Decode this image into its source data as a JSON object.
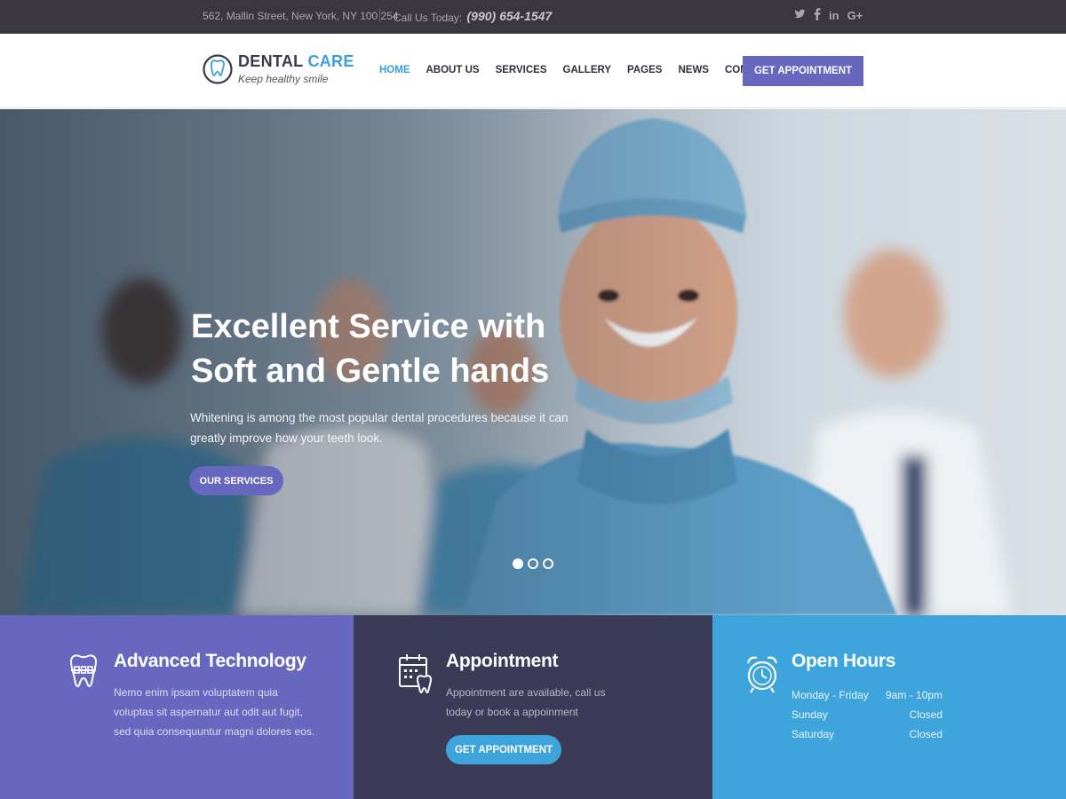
{
  "topbar": {
    "address": "562, Mallin Street, New York, NY 100 254",
    "call_label": "Call Us Today:",
    "phone": "(990) 654-1547",
    "social": [
      {
        "icon": "twitter-icon"
      },
      {
        "icon": "facebook-icon"
      },
      {
        "icon": "linkedin-icon",
        "glyph": "in"
      },
      {
        "icon": "google-plus-icon",
        "glyph": "G+"
      }
    ]
  },
  "header": {
    "logo_part1": "DENTAL",
    "logo_part2": "CARE",
    "tagline": "Keep healthy smile",
    "nav": [
      {
        "label": "HOME",
        "active": true
      },
      {
        "label": "ABOUT US"
      },
      {
        "label": "SERVICES"
      },
      {
        "label": "GALLERY"
      },
      {
        "label": "PAGES"
      },
      {
        "label": "NEWS"
      },
      {
        "label": "CONTACT US"
      }
    ],
    "cta": "GET APPOINTMENT"
  },
  "hero": {
    "title": "Excellent Service with Soft and Gentle hands",
    "text": "Whitening is among the most popular dental procedures because it can greatly improve how your teeth look.",
    "button": "OUR SERVICES",
    "slides": 3,
    "active_slide": 1
  },
  "features": {
    "tech": {
      "title": "Advanced Technology",
      "text": "Nemo enim ipsam voluptatem quia voluptas sit aspernatur aut odit aut fugit, sed quia consequuntur magni dolores eos.",
      "icon": "tooth-braces-icon"
    },
    "appointment": {
      "title": "Appointment",
      "text": "Appointment are available, call us today or book a appoinment",
      "button": "GET APPOINTMENT",
      "icon": "calendar-tooth-icon"
    },
    "hours": {
      "title": "Open Hours",
      "icon": "alarm-clock-icon",
      "rows": [
        {
          "day": "Monday - Friday",
          "time": "9am - 10pm"
        },
        {
          "day": "Sunday",
          "time": "Closed"
        },
        {
          "day": "Saturday",
          "time": "Closed"
        }
      ]
    }
  },
  "colors": {
    "topbar": "#3a3740",
    "accent_purple": "#6767c0",
    "accent_blue": "#3ea4dc",
    "dark_panel": "#3b3b57",
    "nav_active": "#2f9fd8"
  }
}
